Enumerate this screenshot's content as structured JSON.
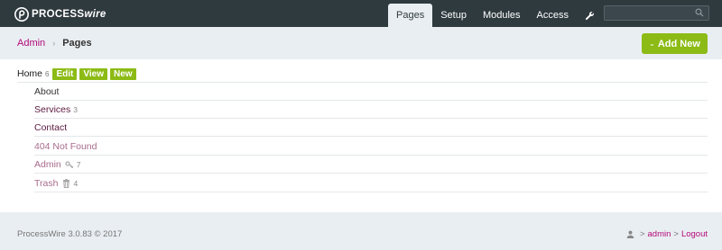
{
  "masthead": {
    "logo": {
      "text_main": "PROCESS",
      "text_italic": "wire"
    },
    "nav": [
      {
        "label": "Pages",
        "active": true
      },
      {
        "label": "Setup",
        "active": false
      },
      {
        "label": "Modules",
        "active": false
      },
      {
        "label": "Access",
        "active": false
      }
    ],
    "tools_icon": "wrench-icon",
    "search": {
      "placeholder": "",
      "icon": "search-icon"
    }
  },
  "breadcrumb": {
    "parent": "Admin",
    "separator": "›",
    "current": "Pages"
  },
  "add_new": {
    "label": "Add New",
    "icon": "chevron-down-icon"
  },
  "tree": {
    "root": {
      "title": "Home",
      "count": "6",
      "actions": [
        "Edit",
        "View",
        "New"
      ]
    },
    "children": [
      {
        "title": "About",
        "count": "",
        "icon": ""
      },
      {
        "title": "Services",
        "count": "3",
        "icon": ""
      },
      {
        "title": "Contact",
        "count": "",
        "icon": ""
      },
      {
        "title": "404 Not Found",
        "count": "",
        "icon": ""
      },
      {
        "title": "Admin",
        "count": "7",
        "icon": "key-icon"
      },
      {
        "title": "Trash",
        "count": "4",
        "icon": "trash-icon"
      }
    ]
  },
  "footer": {
    "version": "ProcessWire 3.0.83 © 2017",
    "user_icon": "user-icon",
    "user": "admin",
    "logout": "Logout",
    "separator": ">"
  },
  "colors": {
    "masthead": "#2f3a3f",
    "accent_green": "#8cbb16",
    "link_magenta": "#b5097a",
    "bar_gray": "#e9eef2"
  }
}
